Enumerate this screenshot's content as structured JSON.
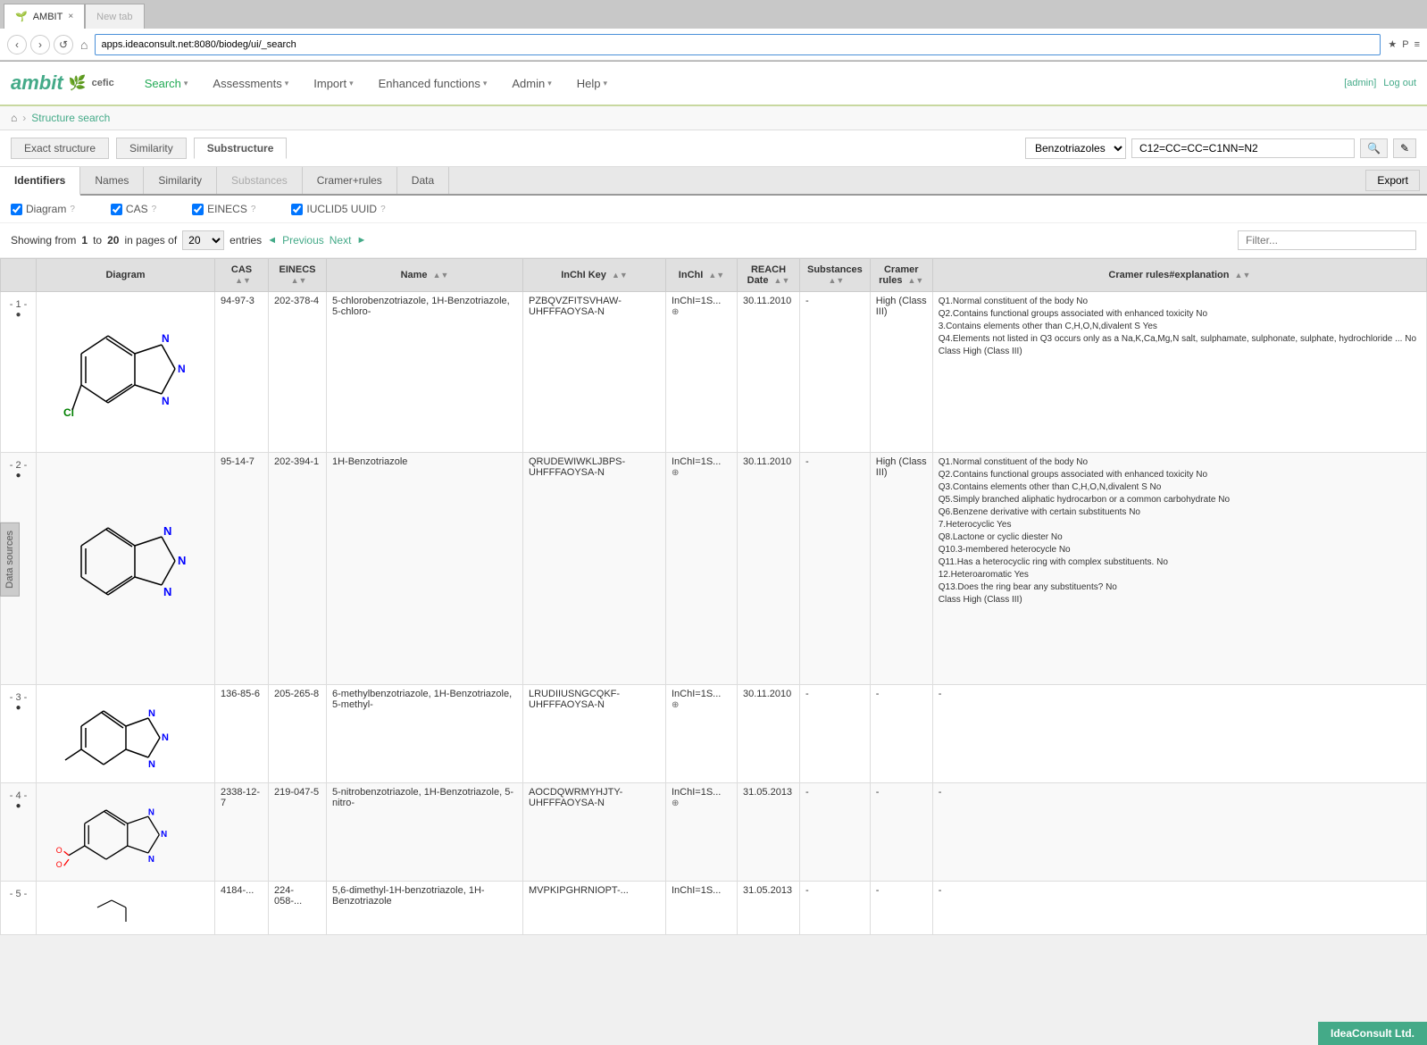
{
  "browser": {
    "tab_title": "AMBIT",
    "tab_close": "×",
    "url": "apps.ideaconsult.net:8080/biodeg/ui/_search",
    "nav_back": "‹",
    "nav_forward": "›",
    "nav_refresh": "↺",
    "browser_icons": [
      "★",
      "P",
      "≡"
    ]
  },
  "header": {
    "logo_text": "ambit",
    "logo_cefic": "cefic",
    "nav_items": [
      {
        "label": "Search",
        "arrow": "▾",
        "active": true
      },
      {
        "label": "Assessments",
        "arrow": "▾"
      },
      {
        "label": "Import",
        "arrow": "▾"
      },
      {
        "label": "Enhanced functions",
        "arrow": "▾"
      },
      {
        "label": "Admin",
        "arrow": "▾"
      },
      {
        "label": "Help",
        "arrow": "▾"
      }
    ],
    "user_admin": "[admin]",
    "user_logout": "Log out"
  },
  "breadcrumb": {
    "home_icon": "⌂",
    "link": "Structure search"
  },
  "search": {
    "tabs": [
      {
        "label": "Exact structure",
        "active": false
      },
      {
        "label": "Similarity",
        "active": false
      },
      {
        "label": "Substructure",
        "active": true
      }
    ],
    "structure_select": "Benzotriazoles",
    "structure_value": "C12=CC=CC=C1NN=N2",
    "search_icon": "🔍",
    "edit_icon": "✎"
  },
  "data_tabs": {
    "tabs": [
      {
        "label": "Identifiers",
        "active": true
      },
      {
        "label": "Names",
        "active": false
      },
      {
        "label": "Similarity",
        "active": false
      },
      {
        "label": "Substances",
        "active": false,
        "disabled": true
      },
      {
        "label": "Cramer+rules",
        "active": false
      },
      {
        "label": "Data",
        "active": false
      }
    ],
    "export_label": "Export"
  },
  "checkboxes": [
    {
      "label": "Diagram",
      "checked": true,
      "q": "?"
    },
    {
      "label": "CAS",
      "checked": true,
      "q": "?"
    },
    {
      "label": "EINECS",
      "checked": true,
      "q": "?"
    },
    {
      "label": "IUCLID5 UUID",
      "checked": true,
      "q": "?"
    }
  ],
  "pagination": {
    "showing_text": "Showing from",
    "from": "1",
    "to_text": "to",
    "to": "20",
    "in_pages_text": "in pages of",
    "page_size": "20",
    "entries_text": "entries",
    "previous_label": "Previous",
    "next_label": "Next",
    "filter_placeholder": "Filter..."
  },
  "table": {
    "columns": [
      "",
      "Diagram",
      "CAS",
      "EINECS",
      "Name",
      "InChI Key",
      "InChI",
      "REACH Date",
      "Substances",
      "Cramer rules",
      "Cramer rules#explanation"
    ],
    "rows": [
      {
        "num": "- 1 -",
        "bullet": "●",
        "cas": "94-97-3",
        "einecs": "202-378-4",
        "name": "5-chlorobenzotriazole, 1H-Benzotriazole, 5-chloro-",
        "inchi_key": "PZBQVZFITSVHAW-UHFFFAOYSA-N",
        "inchi": "InChI=1S...",
        "reach_date": "30.11.2010",
        "substances": "-",
        "cramer_rules": "High (Class III)",
        "cramer_explanation": "Q1.Normal constituent of the body No\nQ2.Contains functional groups associated with enhanced toxicity No\n3.Contains elements other than C,H,O,N,divalent S Yes\nQ4.Elements not listed in Q3 occurs only as a Na,K,Ca,Mg,N salt, sulphamate, sulphonate, sulphate, hydrochloride ... No\nClass High (Class III)"
      },
      {
        "num": "- 2 -",
        "bullet": "●",
        "cas": "95-14-7",
        "einecs": "202-394-1",
        "name": "1H-Benzotriazole",
        "inchi_key": "QRUDEWIWKLJBPS-UHFFFAOYSA-N",
        "inchi": "InChI=1S...",
        "reach_date": "30.11.2010",
        "substances": "-",
        "cramer_rules": "High (Class III)",
        "cramer_explanation": "Q1.Normal constituent of the body No\nQ2.Contains functional groups associated with enhanced toxicity No\nQ3.Contains elements other than C,H,O,N,divalent S No\nQ5.Simply branched aliphatic hydrocarbon or a common carbohydrate No\nQ6.Benzene derivative with certain substituents No\n7.Heterocyclic Yes\nQ8.Lactone or cyclic diester No\nQ10.3-membered heterocycle No\nQ11.Has a heterocyclic ring with complex substituents. No\n12.Heteroaromatic Yes\nQ13.Does the ring bear any substituents? No\nClass High (Class III)"
      },
      {
        "num": "- 3 -",
        "bullet": "●",
        "cas": "136-85-6",
        "einecs": "205-265-8",
        "name": "6-methylbenzotriazole, 1H-Benzotriazole, 5-methyl-",
        "inchi_key": "LRUDIIUSNGCQKF-UHFFFAOYSA-N",
        "inchi": "InChI=1S...",
        "reach_date": "30.11.2010",
        "substances": "-",
        "cramer_rules": "-",
        "cramer_explanation": "-"
      },
      {
        "num": "- 4 -",
        "bullet": "●",
        "cas": "2338-12-7",
        "einecs": "219-047-5",
        "name": "5-nitrobenzotriazole, 1H-Benzotriazole, 5-nitro-",
        "inchi_key": "AOCDQWRMYHJTY-UHFFFAOYSA-N",
        "inchi": "InChI=1S...",
        "reach_date": "31.05.2013",
        "substances": "-",
        "cramer_rules": "-",
        "cramer_explanation": "-"
      },
      {
        "num": "- 5 -",
        "bullet": "●",
        "cas": "4184-...",
        "einecs": "224-058-...",
        "name": "5,6-dimethyl-1H-benzotriazole, 1H-Benzotriazole",
        "inchi_key": "MVPKIPGHRNIOPT-...",
        "inchi": "InChI=1S...",
        "reach_date": "31.05.2013",
        "substances": "-",
        "cramer_rules": "-",
        "cramer_explanation": "-"
      }
    ]
  },
  "data_sources_tab": "Data sources",
  "footer": {
    "badge": "IdeaConsult Ltd."
  }
}
